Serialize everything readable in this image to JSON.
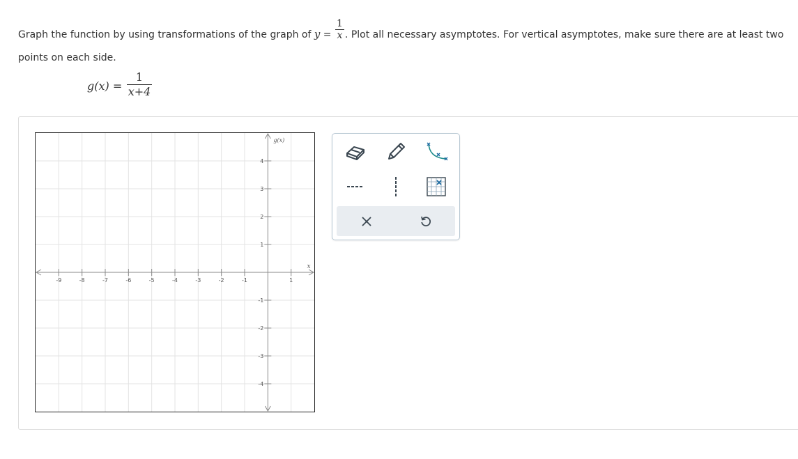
{
  "instructions": {
    "part1": "Graph the function by using transformations of the graph of ",
    "y_var": "y",
    "equals": " = ",
    "frac_num": "1",
    "frac_den": "x",
    "part2": ". Plot all necessary asymptotes. For vertical asymptotes, make sure there are at least two points on each side."
  },
  "function_def": {
    "lhs": "g",
    "lhs_arg": "(x)",
    "equals": " =",
    "numerator": "1",
    "denominator": "x+4"
  },
  "graph": {
    "x_axis_label": "x",
    "y_axis_label": "g(x)",
    "x_min": -10,
    "x_max": 2,
    "y_min": -5,
    "y_max": 5,
    "x_tick_labels": [
      "-9",
      "-8",
      "-7",
      "-6",
      "-5",
      "-4",
      "-3",
      "-2",
      "-1",
      "1"
    ],
    "y_tick_labels": [
      "4",
      "3",
      "2",
      "1",
      "-1",
      "-2",
      "-3",
      "-4"
    ],
    "grid": true
  },
  "toolbox": {
    "tools": [
      "eraser-icon",
      "pencil-icon",
      "curve-tool-icon",
      "horizontal-asymptote-icon",
      "vertical-asymptote-icon",
      "point-grid-icon"
    ],
    "actions": [
      "clear-icon",
      "undo-icon"
    ],
    "accent_color": "#1b8a8a",
    "icon_color": "#3a4650"
  }
}
